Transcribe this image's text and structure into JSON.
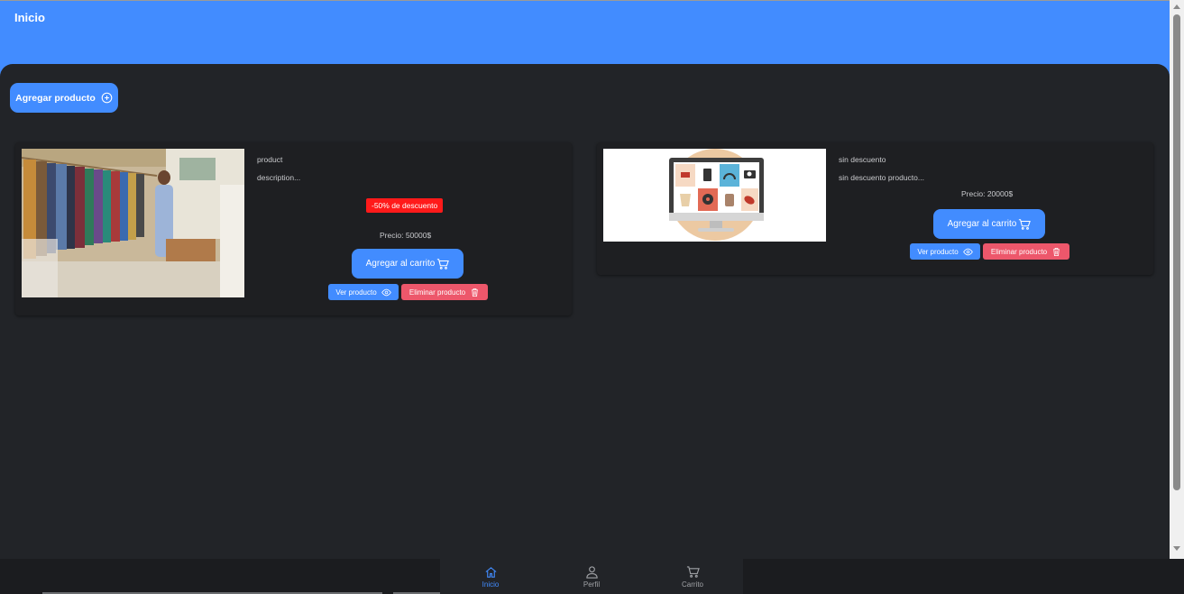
{
  "header": {
    "title": "Inicio"
  },
  "toolbar": {
    "add_product_label": "Agregar producto",
    "add_icon": "add-circle-icon"
  },
  "products": [
    {
      "name": "product",
      "description": "description...",
      "discount_badge": "-50% de descuento",
      "price": "Precio: 50000$",
      "add_to_cart_label": "Agregar al carrito",
      "view_label": "Ver producto",
      "delete_label": "Eliminar producto",
      "image": "clothing-store-photo"
    },
    {
      "name": "sin descuento",
      "description": "sin descuento producto...",
      "price": "Precio: 20000$",
      "add_to_cart_label": "Agregar al carrito",
      "view_label": "Ver producto",
      "delete_label": "Eliminar producto",
      "image": "ecommerce-monitor-illustration"
    }
  ],
  "tabs": [
    {
      "label": "Inicio",
      "icon": "home-icon",
      "active": true
    },
    {
      "label": "Perfil",
      "icon": "person-icon",
      "active": false
    },
    {
      "label": "Carrito",
      "icon": "cart-icon",
      "active": false
    }
  ],
  "colors": {
    "primary": "#428cff",
    "danger": "#ed576b",
    "discount": "#ff1a1a",
    "background": "#222428",
    "card": "#1e1f22"
  }
}
